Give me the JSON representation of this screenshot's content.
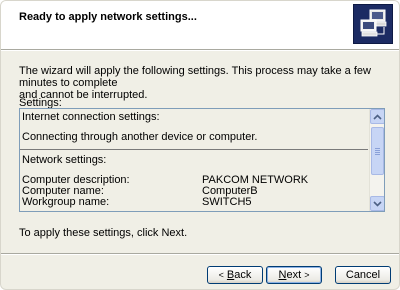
{
  "header": {
    "title": "Ready to apply network settings...",
    "icon": "network-computers-icon"
  },
  "intro": {
    "line1": "The wizard will apply the following settings. This process may take a few minutes to complete",
    "line2": "and cannot be interrupted."
  },
  "settings": {
    "label": "Settings:",
    "internet_heading": "Internet connection settings:",
    "connection": "Connecting through another device or computer.",
    "network_heading": "Network settings:",
    "rows": [
      {
        "label": "Computer description:",
        "value": "PAKCOM NETWORK"
      },
      {
        "label": "Computer name:",
        "value": "ComputerB"
      },
      {
        "label": "Workgroup name:",
        "value": "SWITCH5"
      }
    ]
  },
  "footer": {
    "instruction": "To apply these settings, click Next."
  },
  "buttons": {
    "back": {
      "arrow": "<",
      "key": "B",
      "rest": "ack"
    },
    "next": {
      "key": "N",
      "rest": "ext",
      "arrow": ">"
    },
    "cancel": "Cancel"
  },
  "colors": {
    "header_bg": "#ffffff",
    "body_bg": "#f0efe6",
    "listbox_border": "#7f9db9",
    "button_border": "#003c74",
    "icon_bg": "#1c2b63"
  }
}
